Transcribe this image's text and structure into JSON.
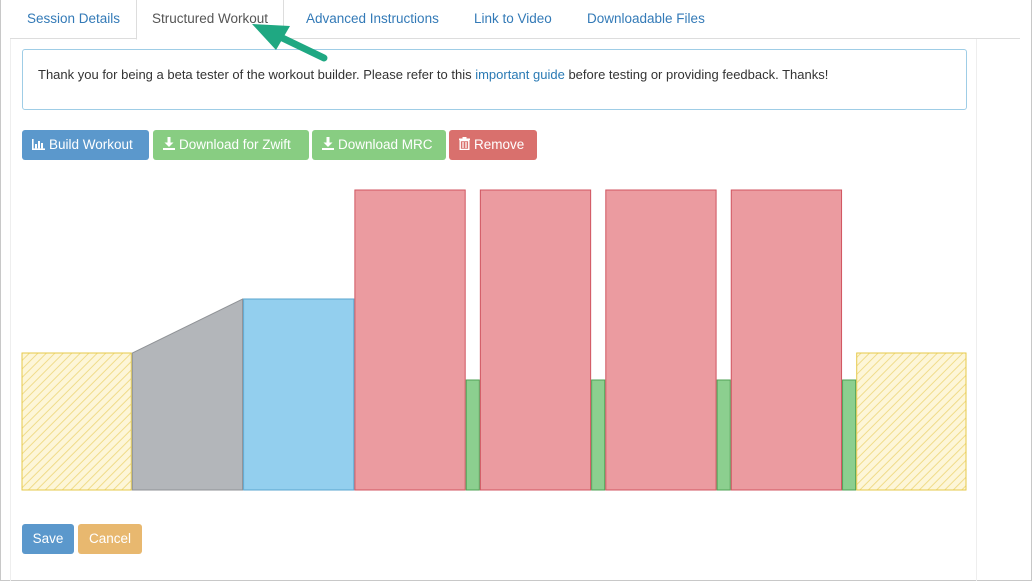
{
  "tabs": [
    {
      "label": "Session Details"
    },
    {
      "label": "Structured Workout"
    },
    {
      "label": "Advanced Instructions"
    },
    {
      "label": "Link to Video"
    },
    {
      "label": "Downloadable Files"
    }
  ],
  "active_tab": "Structured Workout",
  "alert": {
    "before": "Thank you for being a beta tester of the workout builder. Please refer to this ",
    "link": "important guide",
    "after": " before testing or providing feedback. Thanks!"
  },
  "toolbar": {
    "build_label": "Build Workout",
    "zwift_label": "Download for Zwift",
    "mrc_label": "Download MRC",
    "remove_label": "Remove"
  },
  "actions": {
    "save_label": "Save",
    "cancel_label": "Cancel"
  },
  "colors": {
    "link": "#337ab7",
    "primary": "#5b98cc",
    "success": "#88cd82",
    "danger": "#d9706d",
    "warning": "#e8b86f",
    "arrow": "#1fa882"
  },
  "chart_data": {
    "type": "bar",
    "ylim": [
      0,
      300
    ],
    "segments": [
      {
        "kind": "warmup",
        "duration": 108,
        "start": 137,
        "end": 137,
        "fill": "#fdf6d8",
        "stroke": "#e6c94a",
        "pattern": "hatch"
      },
      {
        "kind": "ramp",
        "duration": 109,
        "start": 137,
        "end": 191,
        "fill": "#b3b6ba",
        "stroke": "#8f9296"
      },
      {
        "kind": "steady",
        "duration": 109,
        "start": 191,
        "end": 191,
        "fill": "#93cfee",
        "stroke": "#5aa6cf"
      },
      {
        "kind": "interval",
        "duration": 109,
        "start": 300,
        "end": 300,
        "fill": "#eb9ba0",
        "stroke": "#d05560"
      },
      {
        "kind": "recovery",
        "duration": 13,
        "start": 110,
        "end": 110,
        "fill": "#8ccf8f",
        "stroke": "#4fa055"
      },
      {
        "kind": "interval",
        "duration": 109,
        "start": 300,
        "end": 300,
        "fill": "#eb9ba0",
        "stroke": "#d05560"
      },
      {
        "kind": "recovery",
        "duration": 13,
        "start": 110,
        "end": 110,
        "fill": "#8ccf8f",
        "stroke": "#4fa055"
      },
      {
        "kind": "interval",
        "duration": 109,
        "start": 300,
        "end": 300,
        "fill": "#eb9ba0",
        "stroke": "#d05560"
      },
      {
        "kind": "recovery",
        "duration": 13,
        "start": 110,
        "end": 110,
        "fill": "#8ccf8f",
        "stroke": "#4fa055"
      },
      {
        "kind": "interval",
        "duration": 109,
        "start": 300,
        "end": 300,
        "fill": "#eb9ba0",
        "stroke": "#d05560"
      },
      {
        "kind": "recovery",
        "duration": 13,
        "start": 110,
        "end": 110,
        "fill": "#8ccf8f",
        "stroke": "#4fa055"
      },
      {
        "kind": "cooldown",
        "duration": 108,
        "start": 137,
        "end": 137,
        "fill": "#fdf6d8",
        "stroke": "#e6c94a",
        "pattern": "hatch"
      }
    ]
  }
}
